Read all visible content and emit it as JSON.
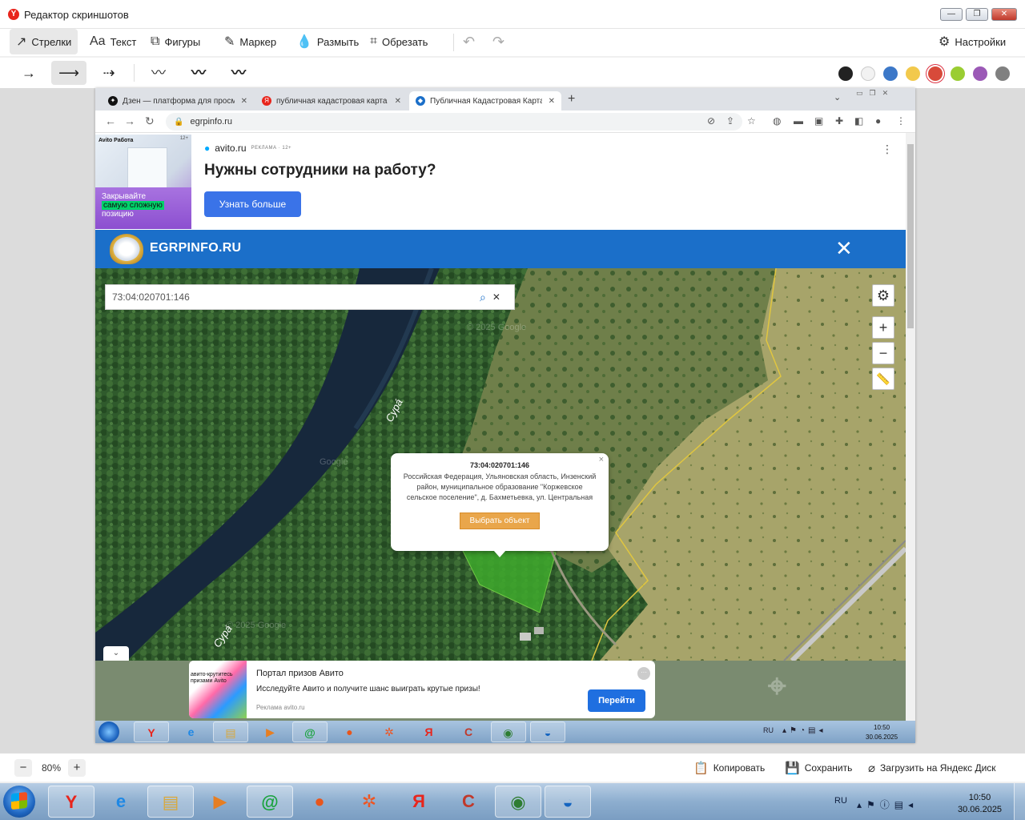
{
  "editor": {
    "title": "Редактор скриншотов",
    "app_icon_letter": "Y",
    "tools": [
      {
        "icon": "arrow-icon",
        "glyph": "↗",
        "label": "Стрелки",
        "active": true
      },
      {
        "icon": "text-icon",
        "glyph": "Aa",
        "label": "Текст",
        "active": false
      },
      {
        "icon": "shapes-icon",
        "glyph": "⧉",
        "label": "Фигуры",
        "active": false
      },
      {
        "icon": "marker-icon",
        "glyph": "✎",
        "label": "Маркер",
        "active": false
      },
      {
        "icon": "blur-icon",
        "glyph": "💧",
        "label": "Размыть",
        "active": false
      },
      {
        "icon": "crop-icon",
        "glyph": "⌗",
        "label": "Обрезать",
        "active": false
      }
    ],
    "undo_glyph": "↶",
    "redo_glyph": "↷",
    "settings_label": "Настройки",
    "strokes": [
      "→",
      "⟶",
      "⇢",
      "〰",
      "〰",
      "〰"
    ],
    "active_stroke": 1,
    "colors": [
      "#222222",
      "#f2f2f2",
      "#3c78c8",
      "#f2c94c",
      "#d84a3a",
      "#9acd32",
      "#9b59b6",
      "#808080"
    ],
    "selected_color": 4,
    "zoom": "80%",
    "zoom_minus": "−",
    "zoom_plus": "+",
    "copy_label": "Копировать",
    "save_label": "Сохранить",
    "upload_label": "Загрузить на Яндекс Диск"
  },
  "browser": {
    "tabs": [
      {
        "title": "Дзен — платформа для просмотра",
        "fav_color": "#111111",
        "fav_glyph": "✦",
        "active": false
      },
      {
        "title": "публичная кадастровая карта — Я",
        "fav_color": "#e8251c",
        "fav_glyph": "Я",
        "active": false
      },
      {
        "title": "Публичная Кадастровая Карта Р",
        "fav_color": "#1b6fc9",
        "fav_glyph": "◆",
        "active": true
      }
    ],
    "new_tab": "+",
    "url": "egrpinfo.ru"
  },
  "ad_top": {
    "image_brand": "Avito Работа",
    "image_badge": "12+",
    "image_caption_1": "Закрывайте",
    "image_caption_hl": "самую сложную",
    "image_caption_2": "позицию",
    "source": "avito.ru",
    "source_tag": "РЕКЛАМА · 12+",
    "headline": "Нужны сотрудники на работу?",
    "button": "Узнать больше"
  },
  "site": {
    "name": "EGRPINFO.RU",
    "close": "✕"
  },
  "map": {
    "search_value": "73:04:020701:146",
    "river_label": "Сура́",
    "watermark": "© 2025 Google",
    "watermark_short": "Google",
    "popup": {
      "cadastral": "73:04:020701:146",
      "address": "Российская Федерация, Ульяновская область, Инзенский район, муниципальное образование \"Коржевское сельское поселение\", д. Бахметьевка, ул. Центральная",
      "button": "Выбрать объект",
      "close": "×"
    },
    "zoom_in": "+",
    "zoom_out": "−",
    "collapse": "⌄"
  },
  "ad_bottom": {
    "thumb_text": "авито-крутитесь призами Avito",
    "title": "Портал призов Авито",
    "text": "Исследуйте Авито и получите шанс выиграть крутые призы!",
    "meta": "Реклама   avito.ru",
    "button": "Перейти",
    "more": "···"
  },
  "inner_taskbar": {
    "lang": "RU",
    "time": "10:50",
    "date": "30.06.2025"
  },
  "taskbar": {
    "lang": "RU",
    "time": "10:50",
    "date": "30.06.2025",
    "apps": [
      {
        "name": "yandex-browser-icon",
        "glyph": "Y",
        "color": "#e8251c",
        "box": true
      },
      {
        "name": "internet-explorer-icon",
        "glyph": "e",
        "color": "#1e88e5",
        "box": false
      },
      {
        "name": "explorer-folder-icon",
        "glyph": "▤",
        "color": "#d9a83a",
        "box": true
      },
      {
        "name": "media-player-icon",
        "glyph": "▶",
        "color": "#e67e22",
        "box": false
      },
      {
        "name": "mail-agent-icon",
        "glyph": "@",
        "color": "#1aa33d",
        "box": true
      },
      {
        "name": "firefox-icon",
        "glyph": "●",
        "color": "#e8561c",
        "box": false
      },
      {
        "name": "ok-icon",
        "glyph": "✲",
        "color": "#ee5522",
        "box": false
      },
      {
        "name": "yandex-icon",
        "glyph": "Я",
        "color": "#e8251c",
        "box": false
      },
      {
        "name": "ccleaner-icon",
        "glyph": "C",
        "color": "#c0392b",
        "box": false
      },
      {
        "name": "chrome-icon",
        "glyph": "◉",
        "color": "#2e7d32",
        "box": true
      },
      {
        "name": "disk-icon",
        "glyph": "◒",
        "color": "#1565c0",
        "box": true
      }
    ]
  }
}
